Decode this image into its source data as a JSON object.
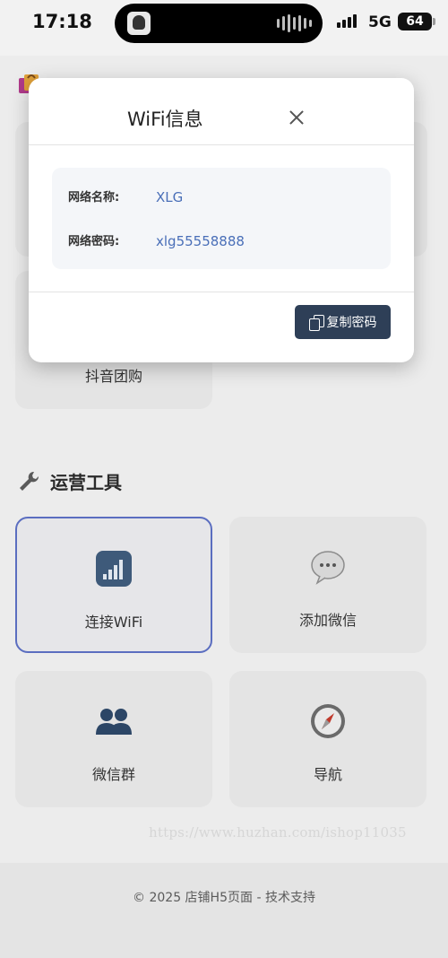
{
  "status_bar": {
    "time": "17:18",
    "network": "5G",
    "battery": "64"
  },
  "sections": {
    "group_buy": {
      "cards": [
        {
          "label": "抖音团购",
          "icon": "douyin-icon"
        }
      ]
    },
    "operations": {
      "title": "运营工具",
      "icon": "wrench-icon",
      "cards": [
        {
          "label": "连接WiFi",
          "icon": "signal-bars-icon"
        },
        {
          "label": "添加微信",
          "icon": "speech-bubble-icon"
        },
        {
          "label": "微信群",
          "icon": "people-icon"
        },
        {
          "label": "导航",
          "icon": "compass-icon"
        }
      ]
    }
  },
  "watermark": "https://www.huzhan.com/ishop11035",
  "footer": {
    "text": "© 2025 店铺H5页面 - 技术支持"
  },
  "modal": {
    "title": "WiFi信息",
    "network_name_label": "网络名称:",
    "network_name": "XLG",
    "password_label": "网络密码:",
    "password": "xlg55558888",
    "copy_button": "复制密码"
  },
  "colors": {
    "accent": "#2e3f57",
    "link": "#4a6fb8",
    "active_border": "#5b6ec0"
  }
}
